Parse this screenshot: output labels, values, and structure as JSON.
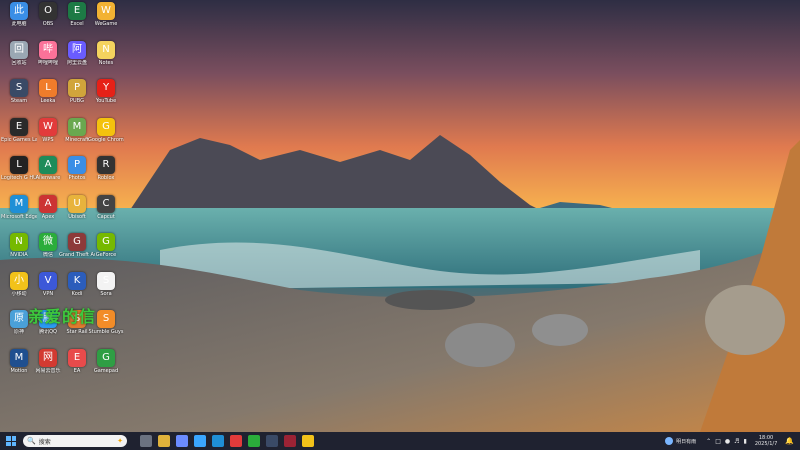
{
  "desktop": {
    "wallpaper_colors": {
      "sky_top": "#2e2e44",
      "sunset_orange": "#f0a14c",
      "sea": "#2f6f7b",
      "rocks": "#6b6b6b",
      "sand": "#c9894f"
    },
    "overlay_text": "亲爱的信",
    "icons": [
      {
        "label": "此电脑",
        "icon": "computer-icon",
        "color": "#3a8ee6"
      },
      {
        "label": "回收站",
        "icon": "recycle-bin-icon",
        "color": "#9aa7b3"
      },
      {
        "label": "Steam",
        "icon": "steam-icon",
        "color": "#3a4a66"
      },
      {
        "label": "Epic Games Launcher",
        "icon": "epic-games-icon",
        "color": "#2a2a2a"
      },
      {
        "label": "Logitech G HUB",
        "icon": "logitech-icon",
        "color": "#222"
      },
      {
        "label": "Microsoft Edge",
        "icon": "edge-icon",
        "color": "#1f8fd6"
      },
      {
        "label": "NVIDIA",
        "icon": "nvidia-icon",
        "color": "#76b900"
      },
      {
        "label": "小移动",
        "icon": "app-icon",
        "color": "#f2c21a"
      },
      {
        "label": "原神",
        "icon": "game-icon",
        "color": "#4aa0d8"
      },
      {
        "label": "Motion",
        "icon": "app-icon",
        "color": "#1f4f8f"
      },
      {
        "label": "OBS",
        "icon": "obs-icon",
        "color": "#333"
      },
      {
        "label": "哔哩哔哩",
        "icon": "bilibili-icon",
        "color": "#fb7299"
      },
      {
        "label": "Leeka",
        "icon": "app-icon",
        "color": "#f07c2b"
      },
      {
        "label": "WPS",
        "icon": "wps-icon",
        "color": "#e23b3b"
      },
      {
        "label": "Alienware",
        "icon": "app-icon",
        "color": "#1e8c5a"
      },
      {
        "label": "Apex",
        "icon": "app-icon",
        "color": "#c33"
      },
      {
        "label": "微信",
        "icon": "wechat-icon",
        "color": "#2bad3b"
      },
      {
        "label": "VPN",
        "icon": "app-icon",
        "color": "#3c58d8"
      },
      {
        "label": "腾讯QQ",
        "icon": "qq-icon",
        "color": "#2a9af0"
      },
      {
        "label": "网易云音乐",
        "icon": "music-icon",
        "color": "#d33a31"
      },
      {
        "label": "Excel",
        "icon": "excel-icon",
        "color": "#1d7a45"
      },
      {
        "label": "阿里云盘",
        "icon": "cloud-icon",
        "color": "#6a5cff"
      },
      {
        "label": "PUBG",
        "icon": "app-icon",
        "color": "#d1a53b"
      },
      {
        "label": "Minecraft",
        "icon": "minecraft-icon",
        "color": "#6aa84f"
      },
      {
        "label": "Photos",
        "icon": "photos-icon",
        "color": "#3a8ee6"
      },
      {
        "label": "Ubisoft",
        "icon": "app-icon",
        "color": "#e8b33c"
      },
      {
        "label": "Grand Theft Auto",
        "icon": "gta-icon",
        "color": "#8d3a3a"
      },
      {
        "label": "Kodi",
        "icon": "app-icon",
        "color": "#2b5dbb"
      },
      {
        "label": "Star Rail",
        "icon": "app-icon",
        "color": "#e07a2e"
      },
      {
        "label": "EA",
        "icon": "ea-icon",
        "color": "#e84b4b"
      },
      {
        "label": "WeGame",
        "icon": "app-icon",
        "color": "#f2b233"
      },
      {
        "label": "Notes",
        "icon": "note-icon",
        "color": "#f4d35e"
      },
      {
        "label": "YouTube",
        "icon": "youtube-icon",
        "color": "#e62117"
      },
      {
        "label": "Google Chrome",
        "icon": "chrome-icon",
        "color": "#f4c20d"
      },
      {
        "label": "Roblox",
        "icon": "app-icon",
        "color": "#333"
      },
      {
        "label": "Capcut",
        "icon": "app-icon",
        "color": "#444"
      },
      {
        "label": "GeForce",
        "icon": "app-icon",
        "color": "#76b900"
      },
      {
        "label": "Sora",
        "icon": "app-icon",
        "color": "#f3f3f3"
      },
      {
        "label": "Stumble Guys",
        "icon": "app-icon",
        "color": "#f28c28"
      },
      {
        "label": "Gamepad",
        "icon": "app-icon",
        "color": "#2f9e44"
      }
    ]
  },
  "taskbar": {
    "search_placeholder": "搜索",
    "apps": [
      {
        "name": "task-view-icon",
        "color": "#6b7280"
      },
      {
        "name": "file-explorer-icon",
        "color": "#e0b23b"
      },
      {
        "name": "settings-icon",
        "color": "#6b8cff"
      },
      {
        "name": "copilot-icon",
        "color": "#3aa6ff"
      },
      {
        "name": "edge-icon",
        "color": "#1f8fd6"
      },
      {
        "name": "wps-icon",
        "color": "#e23b3b"
      },
      {
        "name": "wechat-icon",
        "color": "#2bad3b"
      },
      {
        "name": "steam-icon",
        "color": "#3a4a66"
      },
      {
        "name": "terminal-icon",
        "color": "#9b2335"
      },
      {
        "name": "yellow-app-icon",
        "color": "#f2c21a"
      }
    ],
    "weather_text": "明日有雨",
    "time": "18:00",
    "date": "2025/1/7"
  }
}
